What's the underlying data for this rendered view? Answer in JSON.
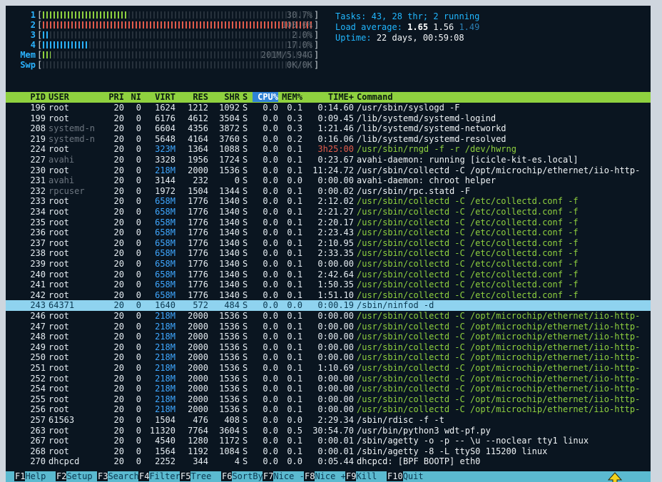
{
  "meters": [
    {
      "label": "1",
      "value": "30.7%",
      "fill": 0.31
    },
    {
      "label": "2",
      "value": "100.0%",
      "fill": 1.0
    },
    {
      "label": "3",
      "value": "2.0%",
      "fill": 0.02
    },
    {
      "label": "4",
      "value": "17.0%",
      "fill": 0.17
    },
    {
      "label": "Mem",
      "value": "201M/5.94G",
      "fill": 0.03
    },
    {
      "label": "Swp",
      "value": "0K/0K",
      "fill": 0.0
    }
  ],
  "info": {
    "tasks_label": "Tasks:",
    "tasks_count": "43,",
    "threads_count": "28",
    "threads_label": "thr;",
    "running_count": "2",
    "running_label": "running",
    "load_label": "Load average:",
    "load1": "1.65",
    "load5": "1.56",
    "load15": "1.49",
    "uptime_label": "Uptime:",
    "uptime_value": "22 days, 00:59:08"
  },
  "table": {
    "headers": [
      "PID",
      "USER",
      "PRI",
      "NI",
      "VIRT",
      "RES",
      "SHR",
      "S",
      "CPU%",
      "MEM%",
      "TIME+",
      "Command"
    ],
    "rows": [
      {
        "pid": "196",
        "user": "root",
        "pri": "20",
        "ni": "0",
        "virt": "1624",
        "res": "1212",
        "shr": "1092",
        "s": "S",
        "cpu": "0.0",
        "mem": "0.1",
        "time": "0:14.60",
        "cmd": "/usr/sbin/syslogd -F",
        "cmd_style": "white"
      },
      {
        "pid": "199",
        "user": "root",
        "pri": "20",
        "ni": "0",
        "virt": "6176",
        "res": "4612",
        "shr": "3504",
        "s": "S",
        "cpu": "0.0",
        "mem": "0.3",
        "time": "0:09.45",
        "cmd": "/lib/systemd/systemd-logind",
        "cmd_style": "white"
      },
      {
        "pid": "208",
        "user": "systemd-n",
        "pri": "20",
        "ni": "0",
        "virt": "6604",
        "res": "4356",
        "shr": "3872",
        "s": "S",
        "cpu": "0.0",
        "mem": "0.3",
        "time": "1:21.46",
        "cmd": "/lib/systemd/systemd-networkd",
        "cmd_style": "white",
        "user_dim": true
      },
      {
        "pid": "219",
        "user": "systemd-n",
        "pri": "20",
        "ni": "0",
        "virt": "5648",
        "res": "4164",
        "shr": "3760",
        "s": "S",
        "cpu": "0.0",
        "mem": "0.2",
        "time": "0:16.06",
        "cmd": "/lib/systemd/systemd-resolved",
        "cmd_style": "white",
        "user_dim": true
      },
      {
        "pid": "224",
        "user": "root",
        "pri": "20",
        "ni": "0",
        "virt": "323M",
        "res": "1364",
        "shr": "1088",
        "s": "S",
        "cpu": "0.0",
        "mem": "0.1",
        "time": "3h25:00",
        "cmd": "/usr/sbin/rngd -f -r /dev/hwrng",
        "cmd_style": "green",
        "virt_blue": true
      },
      {
        "pid": "227",
        "user": "avahi",
        "pri": "20",
        "ni": "0",
        "virt": "3328",
        "res": "1956",
        "shr": "1724",
        "s": "S",
        "cpu": "0.0",
        "mem": "0.1",
        "time": "0:23.67",
        "cmd": "avahi-daemon: running [icicle-kit-es.local]",
        "cmd_style": "white",
        "user_dim": true
      },
      {
        "pid": "230",
        "user": "root",
        "pri": "20",
        "ni": "0",
        "virt": "218M",
        "res": "2000",
        "shr": "1536",
        "s": "S",
        "cpu": "0.0",
        "mem": "0.1",
        "time": "11:24.72",
        "cmd": "/usr/sbin/collectd -C /opt/microchip/ethernet/iio-http-",
        "cmd_style": "white",
        "virt_blue": true
      },
      {
        "pid": "231",
        "user": "avahi",
        "pri": "20",
        "ni": "0",
        "virt": "3144",
        "res": "232",
        "shr": "0",
        "s": "S",
        "cpu": "0.0",
        "mem": "0.0",
        "time": "0:00.00",
        "cmd": "avahi-daemon: chroot helper",
        "cmd_style": "white",
        "user_dim": true
      },
      {
        "pid": "232",
        "user": "rpcuser",
        "pri": "20",
        "ni": "0",
        "virt": "1972",
        "res": "1504",
        "shr": "1344",
        "s": "S",
        "cpu": "0.0",
        "mem": "0.1",
        "time": "0:00.02",
        "cmd": "/usr/sbin/rpc.statd -F",
        "cmd_style": "white",
        "user_dim": true
      },
      {
        "pid": "233",
        "user": "root",
        "pri": "20",
        "ni": "0",
        "virt": "658M",
        "res": "1776",
        "shr": "1340",
        "s": "S",
        "cpu": "0.0",
        "mem": "0.1",
        "time": "2:12.02",
        "cmd": "/usr/sbin/collectd -C /etc/collectd.conf -f",
        "cmd_style": "green",
        "virt_blue": true
      },
      {
        "pid": "234",
        "user": "root",
        "pri": "20",
        "ni": "0",
        "virt": "658M",
        "res": "1776",
        "shr": "1340",
        "s": "S",
        "cpu": "0.0",
        "mem": "0.1",
        "time": "2:21.27",
        "cmd": "/usr/sbin/collectd -C /etc/collectd.conf -f",
        "cmd_style": "green",
        "virt_blue": true
      },
      {
        "pid": "235",
        "user": "root",
        "pri": "20",
        "ni": "0",
        "virt": "658M",
        "res": "1776",
        "shr": "1340",
        "s": "S",
        "cpu": "0.0",
        "mem": "0.1",
        "time": "2:20.17",
        "cmd": "/usr/sbin/collectd -C /etc/collectd.conf -f",
        "cmd_style": "green",
        "virt_blue": true
      },
      {
        "pid": "236",
        "user": "root",
        "pri": "20",
        "ni": "0",
        "virt": "658M",
        "res": "1776",
        "shr": "1340",
        "s": "S",
        "cpu": "0.0",
        "mem": "0.1",
        "time": "2:23.43",
        "cmd": "/usr/sbin/collectd -C /etc/collectd.conf -f",
        "cmd_style": "green",
        "virt_blue": true
      },
      {
        "pid": "237",
        "user": "root",
        "pri": "20",
        "ni": "0",
        "virt": "658M",
        "res": "1776",
        "shr": "1340",
        "s": "S",
        "cpu": "0.0",
        "mem": "0.1",
        "time": "2:10.95",
        "cmd": "/usr/sbin/collectd -C /etc/collectd.conf -f",
        "cmd_style": "green",
        "virt_blue": true
      },
      {
        "pid": "238",
        "user": "root",
        "pri": "20",
        "ni": "0",
        "virt": "658M",
        "res": "1776",
        "shr": "1340",
        "s": "S",
        "cpu": "0.0",
        "mem": "0.1",
        "time": "2:33.35",
        "cmd": "/usr/sbin/collectd -C /etc/collectd.conf -f",
        "cmd_style": "green",
        "virt_blue": true
      },
      {
        "pid": "239",
        "user": "root",
        "pri": "20",
        "ni": "0",
        "virt": "658M",
        "res": "1776",
        "shr": "1340",
        "s": "S",
        "cpu": "0.0",
        "mem": "0.1",
        "time": "0:00.00",
        "cmd": "/usr/sbin/collectd -C /etc/collectd.conf -f",
        "cmd_style": "green",
        "virt_blue": true
      },
      {
        "pid": "240",
        "user": "root",
        "pri": "20",
        "ni": "0",
        "virt": "658M",
        "res": "1776",
        "shr": "1340",
        "s": "S",
        "cpu": "0.0",
        "mem": "0.1",
        "time": "2:42.64",
        "cmd": "/usr/sbin/collectd -C /etc/collectd.conf -f",
        "cmd_style": "green",
        "virt_blue": true
      },
      {
        "pid": "241",
        "user": "root",
        "pri": "20",
        "ni": "0",
        "virt": "658M",
        "res": "1776",
        "shr": "1340",
        "s": "S",
        "cpu": "0.0",
        "mem": "0.1",
        "time": "1:50.35",
        "cmd": "/usr/sbin/collectd -C /etc/collectd.conf -f",
        "cmd_style": "green",
        "virt_blue": true
      },
      {
        "pid": "242",
        "user": "root",
        "pri": "20",
        "ni": "0",
        "virt": "658M",
        "res": "1776",
        "shr": "1340",
        "s": "S",
        "cpu": "0.0",
        "mem": "0.1",
        "time": "1:51.10",
        "cmd": "/usr/sbin/collectd -C /etc/collectd.conf -f",
        "cmd_style": "green",
        "virt_blue": true
      },
      {
        "pid": "243",
        "user": "64371",
        "pri": "20",
        "ni": "0",
        "virt": "1640",
        "res": "572",
        "shr": "484",
        "s": "S",
        "cpu": "0.0",
        "mem": "0.0",
        "time": "0:00.19",
        "cmd": "/sbin/ninfod -d",
        "cmd_style": "white",
        "selected": true
      },
      {
        "pid": "246",
        "user": "root",
        "pri": "20",
        "ni": "0",
        "virt": "218M",
        "res": "2000",
        "shr": "1536",
        "s": "S",
        "cpu": "0.0",
        "mem": "0.1",
        "time": "0:00.00",
        "cmd": "/usr/sbin/collectd -C /opt/microchip/ethernet/iio-http-",
        "cmd_style": "green",
        "virt_blue": true
      },
      {
        "pid": "247",
        "user": "root",
        "pri": "20",
        "ni": "0",
        "virt": "218M",
        "res": "2000",
        "shr": "1536",
        "s": "S",
        "cpu": "0.0",
        "mem": "0.1",
        "time": "0:00.00",
        "cmd": "/usr/sbin/collectd -C /opt/microchip/ethernet/iio-http-",
        "cmd_style": "green",
        "virt_blue": true
      },
      {
        "pid": "248",
        "user": "root",
        "pri": "20",
        "ni": "0",
        "virt": "218M",
        "res": "2000",
        "shr": "1536",
        "s": "S",
        "cpu": "0.0",
        "mem": "0.1",
        "time": "0:00.00",
        "cmd": "/usr/sbin/collectd -C /opt/microchip/ethernet/iio-http-",
        "cmd_style": "green",
        "virt_blue": true
      },
      {
        "pid": "249",
        "user": "root",
        "pri": "20",
        "ni": "0",
        "virt": "218M",
        "res": "2000",
        "shr": "1536",
        "s": "S",
        "cpu": "0.0",
        "mem": "0.1",
        "time": "0:00.00",
        "cmd": "/usr/sbin/collectd -C /opt/microchip/ethernet/iio-http-",
        "cmd_style": "green",
        "virt_blue": true
      },
      {
        "pid": "250",
        "user": "root",
        "pri": "20",
        "ni": "0",
        "virt": "218M",
        "res": "2000",
        "shr": "1536",
        "s": "S",
        "cpu": "0.0",
        "mem": "0.1",
        "time": "0:00.00",
        "cmd": "/usr/sbin/collectd -C /opt/microchip/ethernet/iio-http-",
        "cmd_style": "green",
        "virt_blue": true
      },
      {
        "pid": "251",
        "user": "root",
        "pri": "20",
        "ni": "0",
        "virt": "218M",
        "res": "2000",
        "shr": "1536",
        "s": "S",
        "cpu": "0.0",
        "mem": "0.1",
        "time": "1:10.69",
        "cmd": "/usr/sbin/collectd -C /opt/microchip/ethernet/iio-http-",
        "cmd_style": "green",
        "virt_blue": true
      },
      {
        "pid": "252",
        "user": "root",
        "pri": "20",
        "ni": "0",
        "virt": "218M",
        "res": "2000",
        "shr": "1536",
        "s": "S",
        "cpu": "0.0",
        "mem": "0.1",
        "time": "0:00.00",
        "cmd": "/usr/sbin/collectd -C /opt/microchip/ethernet/iio-http-",
        "cmd_style": "green",
        "virt_blue": true
      },
      {
        "pid": "254",
        "user": "root",
        "pri": "20",
        "ni": "0",
        "virt": "218M",
        "res": "2000",
        "shr": "1536",
        "s": "S",
        "cpu": "0.0",
        "mem": "0.1",
        "time": "0:00.00",
        "cmd": "/usr/sbin/collectd -C /opt/microchip/ethernet/iio-http-",
        "cmd_style": "green",
        "virt_blue": true
      },
      {
        "pid": "255",
        "user": "root",
        "pri": "20",
        "ni": "0",
        "virt": "218M",
        "res": "2000",
        "shr": "1536",
        "s": "S",
        "cpu": "0.0",
        "mem": "0.1",
        "time": "0:00.00",
        "cmd": "/usr/sbin/collectd -C /opt/microchip/ethernet/iio-http-",
        "cmd_style": "green",
        "virt_blue": true
      },
      {
        "pid": "256",
        "user": "root",
        "pri": "20",
        "ni": "0",
        "virt": "218M",
        "res": "2000",
        "shr": "1536",
        "s": "S",
        "cpu": "0.0",
        "mem": "0.1",
        "time": "0:00.00",
        "cmd": "/usr/sbin/collectd -C /opt/microchip/ethernet/iio-http-",
        "cmd_style": "green",
        "virt_blue": true
      },
      {
        "pid": "257",
        "user": "61563",
        "pri": "20",
        "ni": "0",
        "virt": "1504",
        "res": "476",
        "shr": "408",
        "s": "S",
        "cpu": "0.0",
        "mem": "0.0",
        "time": "2:29.34",
        "cmd": "/sbin/rdisc -f -t",
        "cmd_style": "white"
      },
      {
        "pid": "263",
        "user": "root",
        "pri": "20",
        "ni": "0",
        "virt": "11320",
        "res": "7764",
        "shr": "3604",
        "s": "S",
        "cpu": "0.0",
        "mem": "0.5",
        "time": "30:54.70",
        "cmd": "/usr/bin/python3 wdt-pf.py",
        "cmd_style": "white"
      },
      {
        "pid": "267",
        "user": "root",
        "pri": "20",
        "ni": "0",
        "virt": "4540",
        "res": "1280",
        "shr": "1172",
        "s": "S",
        "cpu": "0.0",
        "mem": "0.1",
        "time": "0:00.01",
        "cmd": "/sbin/agetty -o -p -- \\u --noclear tty1 linux",
        "cmd_style": "white"
      },
      {
        "pid": "268",
        "user": "root",
        "pri": "20",
        "ni": "0",
        "virt": "1564",
        "res": "1192",
        "shr": "1084",
        "s": "S",
        "cpu": "0.0",
        "mem": "0.1",
        "time": "0:00.01",
        "cmd": "/sbin/agetty -8 -L ttyS0 115200 linux",
        "cmd_style": "white"
      },
      {
        "pid": "270",
        "user": "dhcpcd",
        "pri": "20",
        "ni": "0",
        "virt": "2252",
        "res": "344",
        "shr": "4",
        "s": "S",
        "cpu": "0.0",
        "mem": "0.0",
        "time": "0:05.44",
        "cmd": "dhcpcd: [BPF BOOTP] eth0",
        "cmd_style": "white"
      }
    ]
  },
  "footer": [
    {
      "key": "F1",
      "label": "Help"
    },
    {
      "key": "F2",
      "label": "Setup"
    },
    {
      "key": "F3",
      "label": "Search"
    },
    {
      "key": "F4",
      "label": "Filter"
    },
    {
      "key": "F5",
      "label": "Tree"
    },
    {
      "key": "F6",
      "label": "SortBy"
    },
    {
      "key": "F7",
      "label": "Nice -"
    },
    {
      "key": "F8",
      "label": "Nice +"
    },
    {
      "key": "F9",
      "label": "Kill"
    },
    {
      "key": "F10",
      "label": "Quit"
    }
  ],
  "colors": {
    "background": "#0a1520",
    "header_bar": "#8fd13f",
    "selected_row": "#8fd3ef",
    "sort_column": "#2f82d7",
    "cursor": "#f2d21b"
  },
  "icons": {
    "cursor": "arrow-up-icon"
  }
}
